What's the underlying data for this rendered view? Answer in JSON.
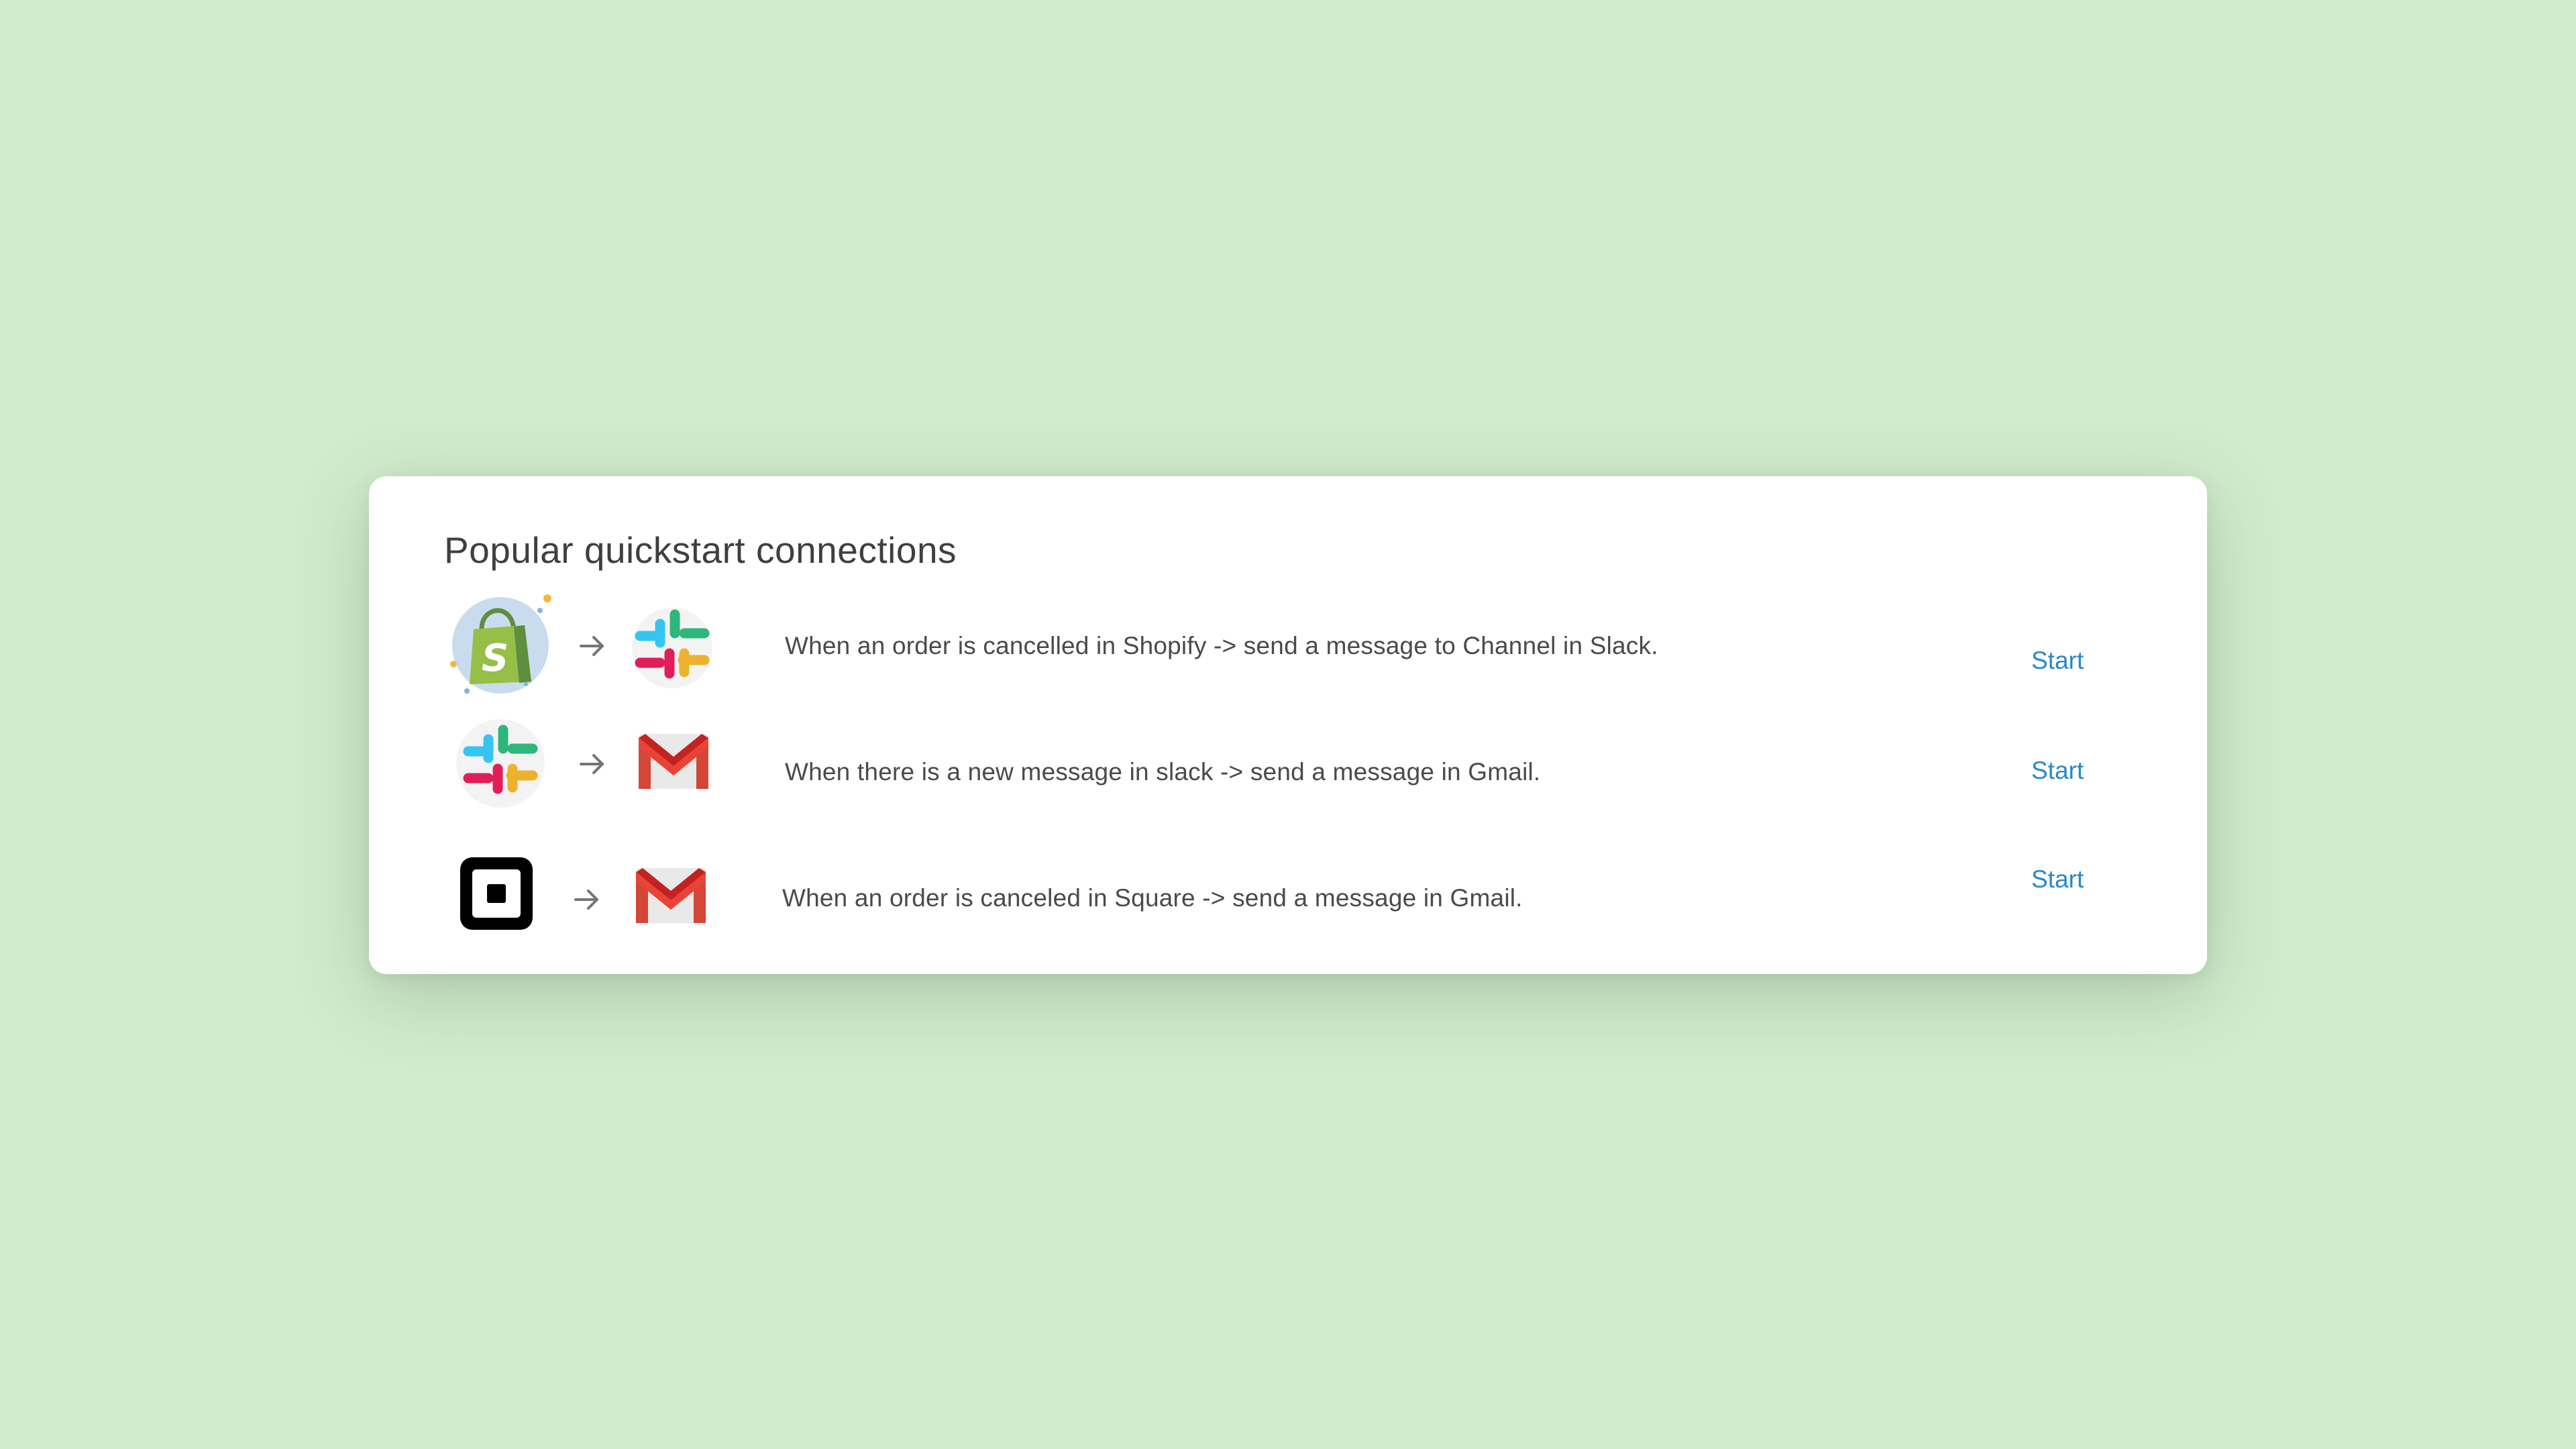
{
  "card": {
    "title": "Popular quickstart connections"
  },
  "connections": [
    {
      "source_icon": "shopify-icon",
      "target_icon": "slack-icon",
      "description": "When an order is cancelled in Shopify -> send a message to Channel in Slack.",
      "action_label": "Start"
    },
    {
      "source_icon": "slack-icon",
      "target_icon": "gmail-icon",
      "description": "When there is a new message in slack -> send a message in Gmail.",
      "action_label": "Start"
    },
    {
      "source_icon": "square-icon",
      "target_icon": "gmail-icon",
      "description": "When an order is canceled in Square -> send a message in Gmail.",
      "action_label": "Start"
    }
  ],
  "colors": {
    "background": "#d1ebcd",
    "card": "#ffffff",
    "title_text": "#3f3f3f",
    "body_text": "#4a4a4a",
    "link": "#2a88c9",
    "arrow": "#757575"
  }
}
